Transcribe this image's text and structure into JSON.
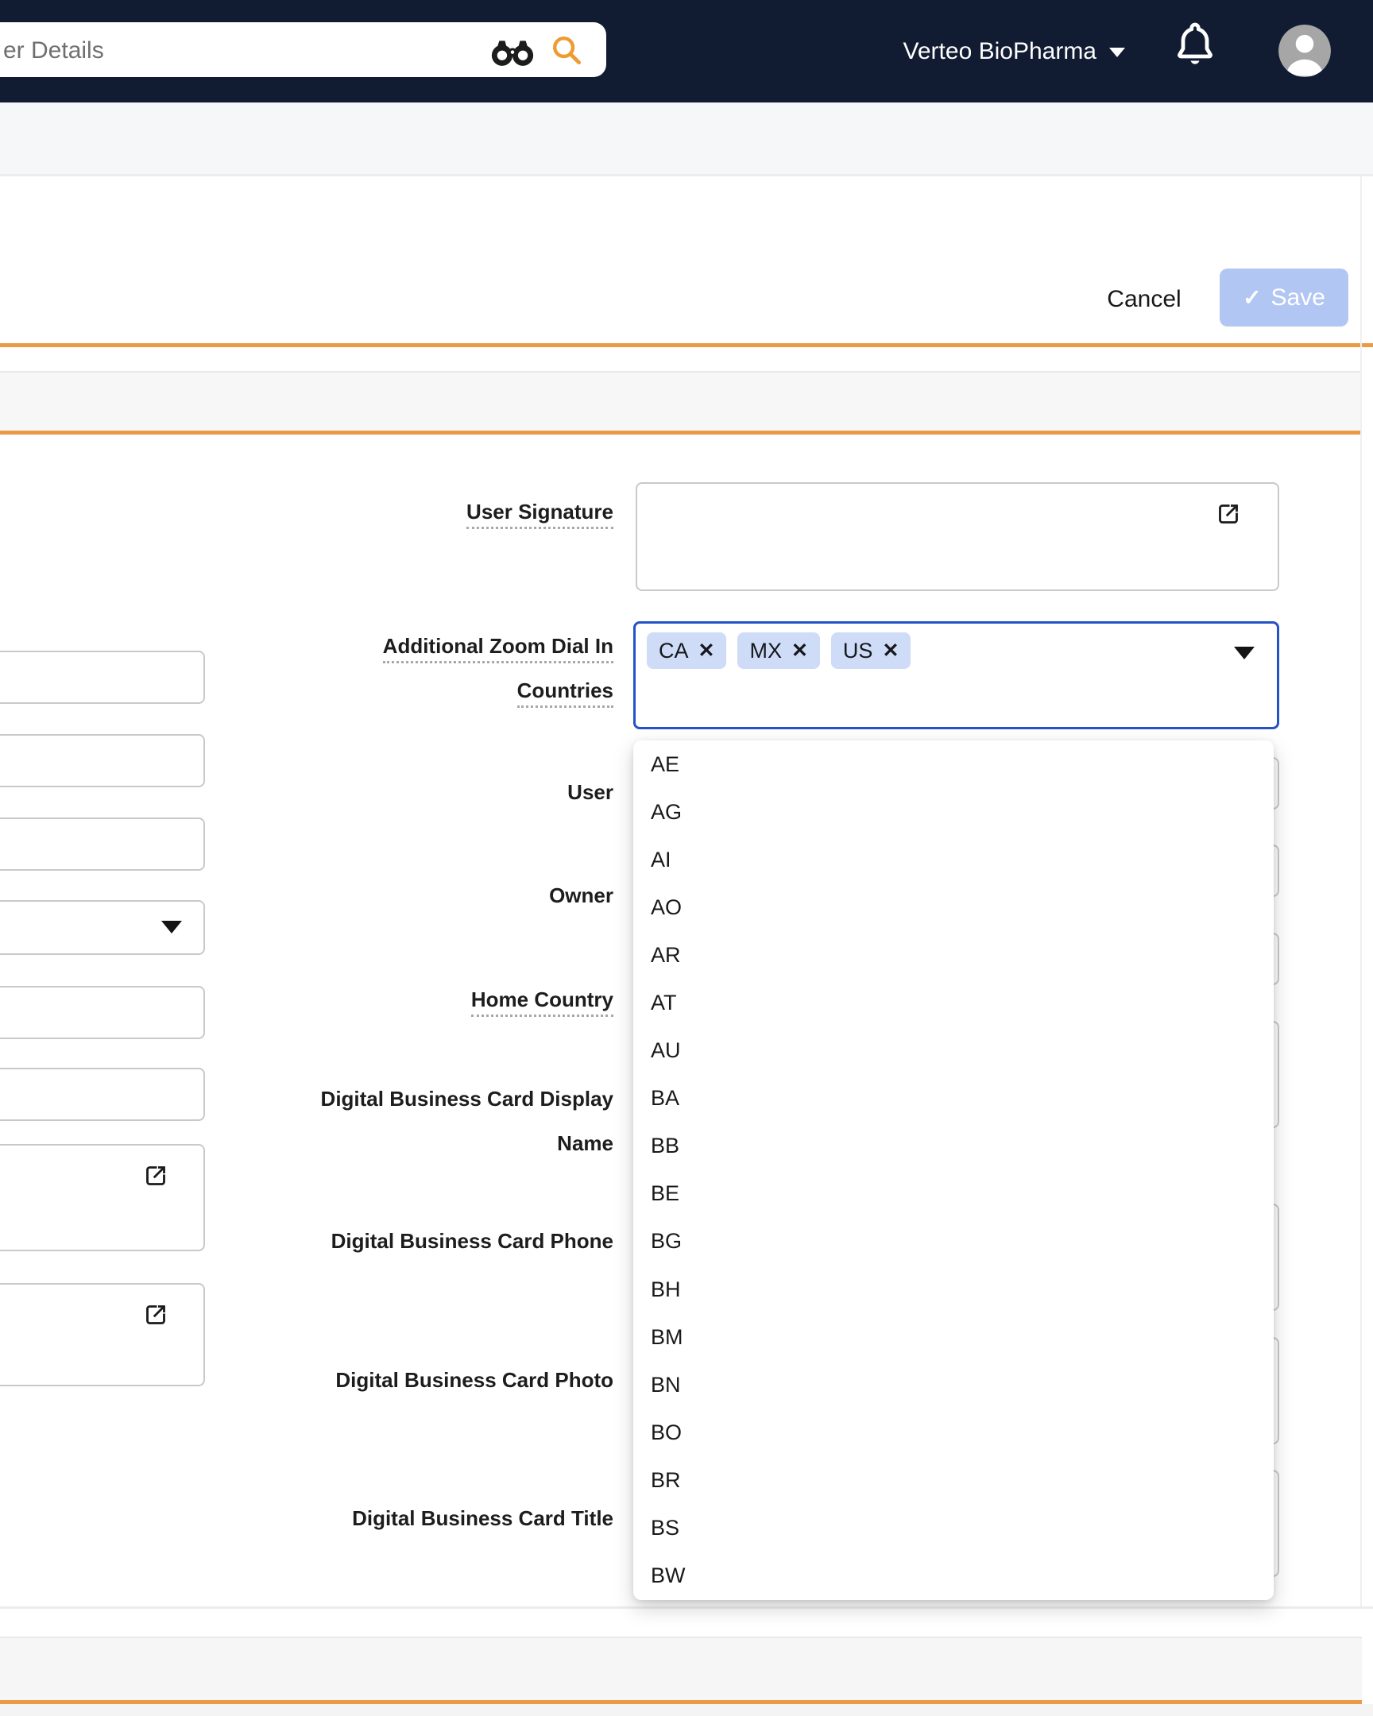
{
  "navbar": {
    "search_value": "er Details",
    "brand": "Verteo BioPharma"
  },
  "actions": {
    "cancel_label": "Cancel",
    "save_label": "Save",
    "save_check_glyph": "✓"
  },
  "form_labels": {
    "user_signature": "User Signature",
    "additional_zoom_line1": "Additional Zoom Dial In",
    "additional_zoom_line2": "Countries",
    "user": "User",
    "owner": "Owner",
    "home_country": "Home Country",
    "dbc_display_line1": "Digital Business Card Display",
    "dbc_display_line2": "Name",
    "dbc_phone": "Digital Business Card Phone",
    "dbc_photo": "Digital Business Card Photo",
    "dbc_title": "Digital Business Card Title"
  },
  "multiselect": {
    "selected": [
      "CA",
      "MX",
      "US"
    ],
    "remove_glyph": "✕"
  },
  "dropdown_options": [
    "AE",
    "AG",
    "AI",
    "AO",
    "AR",
    "AT",
    "AU",
    "BA",
    "BB",
    "BE",
    "BG",
    "BH",
    "BM",
    "BN",
    "BO",
    "BR",
    "BS",
    "BW"
  ],
  "colors": {
    "accent_orange": "#e99a43",
    "navbar_navy": "#111c33",
    "focus_blue": "#2453c6",
    "chip_bg": "#cfdcf8",
    "save_bg": "#b2c6f3"
  }
}
